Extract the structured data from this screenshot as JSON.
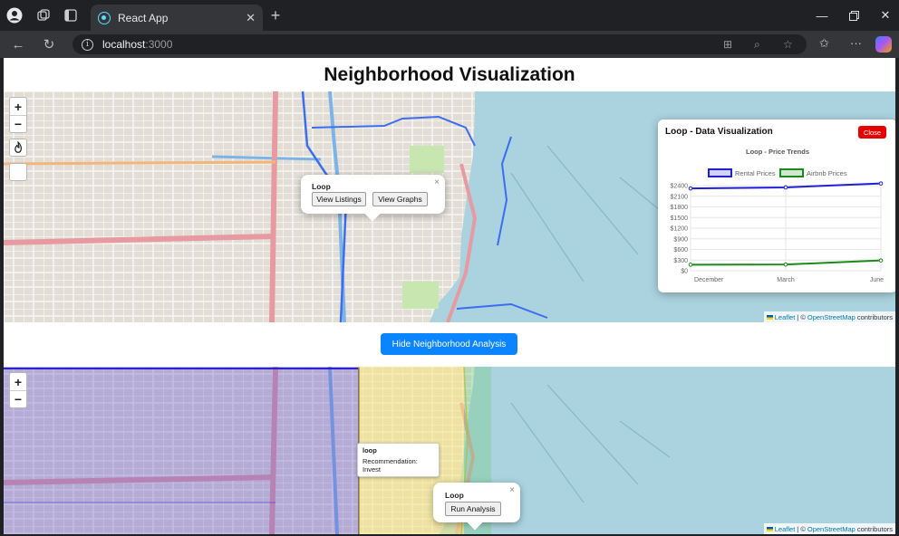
{
  "browser": {
    "tab_title": "React App",
    "url_host": "localhost",
    "url_port": ":3000"
  },
  "page": {
    "title": "Neighborhood Visualization",
    "toggle_button": "Hide Neighborhood Analysis"
  },
  "map_top": {
    "zoom_in": "+",
    "zoom_out": "−",
    "popup": {
      "title": "Loop",
      "view_listings": "View Listings",
      "view_graphs": "View Graphs",
      "close": "×"
    },
    "attribution": {
      "leaflet": "Leaflet",
      "sep": "| ©",
      "osm": "OpenStreetMap",
      "contributors": "contributors"
    }
  },
  "map_bottom": {
    "zoom_in": "+",
    "zoom_out": "−",
    "tooltip": {
      "name": "loop",
      "recommendation": "Recommendation: Invest"
    },
    "popup": {
      "title": "Loop",
      "run_analysis": "Run Analysis",
      "close": "×"
    },
    "attribution": {
      "leaflet": "Leaflet",
      "sep": "| ©",
      "osm": "OpenStreetMap",
      "contributors": "contributors"
    }
  },
  "chart_panel": {
    "heading": "Loop - Data Visualization",
    "close_label": "Close"
  },
  "chart_data": {
    "type": "line",
    "title": "Loop - Price Trends",
    "categories": [
      "December",
      "March",
      "June"
    ],
    "y_ticks": [
      "$2400",
      "$2100",
      "$1800",
      "$1500",
      "$1200",
      "$900",
      "$600",
      "$300",
      "$0"
    ],
    "ylim": [
      0,
      2400
    ],
    "series": [
      {
        "name": "Rental Prices",
        "values": [
          2320,
          2350,
          2460
        ],
        "color": "#1f1fd6"
      },
      {
        "name": "Airbnb Prices",
        "values": [
          170,
          175,
          290
        ],
        "color": "#1a8a1a"
      }
    ],
    "legend": "top",
    "grid": true
  }
}
